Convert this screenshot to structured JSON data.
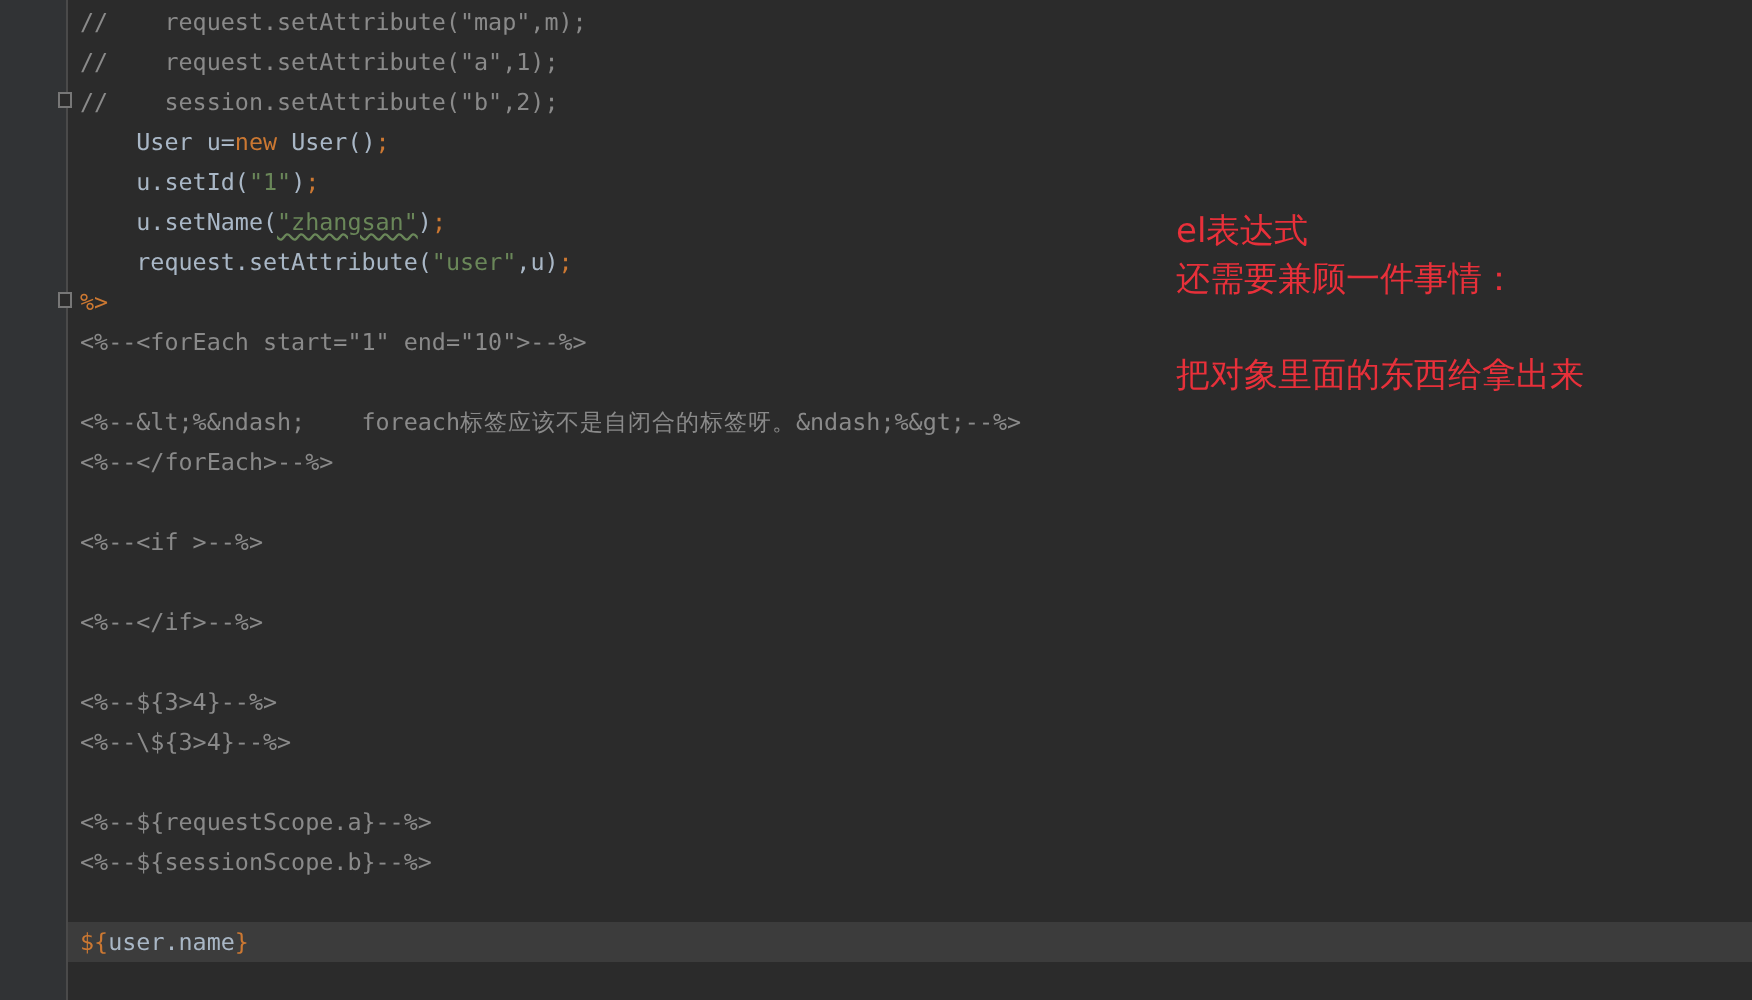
{
  "editor": {
    "lines": [
      {
        "kind": "code",
        "fold": false,
        "current": false,
        "segments": [
          {
            "kind": "comment",
            "text": "//    request.setAttribute(\"map\",m);"
          }
        ]
      },
      {
        "kind": "code",
        "fold": false,
        "current": false,
        "segments": [
          {
            "kind": "comment",
            "text": "//    request.setAttribute(\"a\",1);"
          }
        ]
      },
      {
        "kind": "code",
        "fold": true,
        "current": false,
        "segments": [
          {
            "kind": "comment",
            "text": "//    session.setAttribute(\"b\",2);"
          }
        ]
      },
      {
        "kind": "code",
        "fold": false,
        "current": false,
        "segments": [
          {
            "kind": "plain",
            "text": "    User u="
          },
          {
            "kind": "keyword",
            "text": "new"
          },
          {
            "kind": "plain",
            "text": " User()"
          },
          {
            "kind": "keyword",
            "text": ";"
          }
        ]
      },
      {
        "kind": "code",
        "fold": false,
        "current": false,
        "segments": [
          {
            "kind": "plain",
            "text": "    u.setId("
          },
          {
            "kind": "string",
            "text": "\"1\""
          },
          {
            "kind": "plain",
            "text": ")"
          },
          {
            "kind": "keyword",
            "text": ";"
          }
        ]
      },
      {
        "kind": "code",
        "fold": false,
        "current": false,
        "segments": [
          {
            "kind": "plain",
            "text": "    u.setName("
          },
          {
            "kind": "typo",
            "text": "\"zhangsan\""
          },
          {
            "kind": "plain",
            "text": ")"
          },
          {
            "kind": "keyword",
            "text": ";"
          }
        ]
      },
      {
        "kind": "code",
        "fold": false,
        "current": false,
        "segments": [
          {
            "kind": "plain",
            "text": "    request.setAttribute("
          },
          {
            "kind": "string",
            "text": "\"user\""
          },
          {
            "kind": "plain",
            "text": ",u)"
          },
          {
            "kind": "keyword",
            "text": ";"
          }
        ]
      },
      {
        "kind": "code",
        "fold": true,
        "current": false,
        "segments": [
          {
            "kind": "delim",
            "text": "%>"
          }
        ]
      },
      {
        "kind": "code",
        "fold": false,
        "current": false,
        "segments": [
          {
            "kind": "comment",
            "text": "<%--<forEach start=\"1\" end=\"10\">--%>"
          }
        ]
      },
      {
        "kind": "blank",
        "fold": false,
        "current": false
      },
      {
        "kind": "code",
        "fold": false,
        "current": false,
        "segments": [
          {
            "kind": "comment",
            "text": "<%--&lt;%&ndash;    foreach标签应该不是自闭合的标签呀。&ndash;%&gt;--%>"
          }
        ]
      },
      {
        "kind": "code",
        "fold": false,
        "current": false,
        "segments": [
          {
            "kind": "comment",
            "text": "<%--</forEach>--%>"
          }
        ]
      },
      {
        "kind": "blank",
        "fold": false,
        "current": false
      },
      {
        "kind": "code",
        "fold": false,
        "current": false,
        "segments": [
          {
            "kind": "comment",
            "text": "<%--<if >--%>"
          }
        ]
      },
      {
        "kind": "blank",
        "fold": false,
        "current": false
      },
      {
        "kind": "code",
        "fold": false,
        "current": false,
        "segments": [
          {
            "kind": "comment",
            "text": "<%--</if>--%>"
          }
        ]
      },
      {
        "kind": "blank",
        "fold": false,
        "current": false
      },
      {
        "kind": "code",
        "fold": false,
        "current": false,
        "segments": [
          {
            "kind": "comment",
            "text": "<%--${3>4}--%>"
          }
        ]
      },
      {
        "kind": "code",
        "fold": false,
        "current": false,
        "segments": [
          {
            "kind": "comment",
            "text": "<%--\\${3>4}--%>"
          }
        ]
      },
      {
        "kind": "blank",
        "fold": false,
        "current": false
      },
      {
        "kind": "code",
        "fold": false,
        "current": false,
        "segments": [
          {
            "kind": "comment",
            "text": "<%--${requestScope.a}--%>"
          }
        ]
      },
      {
        "kind": "code",
        "fold": false,
        "current": false,
        "segments": [
          {
            "kind": "comment",
            "text": "<%--${sessionScope.b}--%>"
          }
        ]
      },
      {
        "kind": "blank",
        "fold": false,
        "current": false
      },
      {
        "kind": "code",
        "fold": false,
        "current": true,
        "segments": [
          {
            "kind": "delim",
            "text": "${"
          },
          {
            "kind": "plain",
            "text": "user.name"
          },
          {
            "kind": "delim",
            "text": "}"
          }
        ]
      }
    ]
  },
  "note": {
    "paragraphs": [
      {
        "lines": [
          "el表达式",
          "还需要兼顾一件事情："
        ]
      },
      {
        "lines": [
          "把对象里面的东西给拿出来"
        ]
      }
    ]
  }
}
